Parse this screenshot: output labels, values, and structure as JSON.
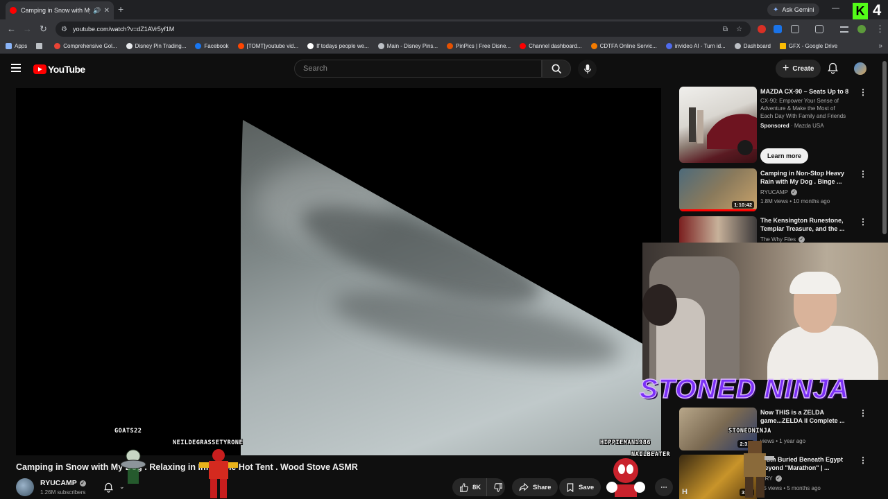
{
  "browser": {
    "tab_title": "Camping in Snow with My",
    "url": "youtube.com/watch?v=dZ1AVr5yf1M",
    "ask_gemini": "Ask Gemini",
    "k_count": "4",
    "bookmarks": [
      {
        "label": "Apps",
        "color": "#8ab4f8"
      },
      {
        "label": "Comprehensive Gol...",
        "color": "#ea4335"
      },
      {
        "label": "Disney Pin Trading...",
        "color": "#e8eaed"
      },
      {
        "label": "Facebook",
        "color": "#1877f2"
      },
      {
        "label": "[TOMT]youtube vid...",
        "color": "#ff4500"
      },
      {
        "label": "If todays people we...",
        "color": "#ffffff"
      },
      {
        "label": "Main - Disney Pins...",
        "color": "#bdc1c6"
      },
      {
        "label": "PinPics | Free Disne...",
        "color": "#e65100"
      },
      {
        "label": "Channel dashboard...",
        "color": "#ff0000"
      },
      {
        "label": "CDTFA Online Servic...",
        "color": "#f57c00"
      },
      {
        "label": "invideo AI - Turn id...",
        "color": "#4f6bed"
      },
      {
        "label": "Dashboard",
        "color": "#bdc1c6"
      },
      {
        "label": "GFX - Google Drive",
        "color": "#fbbc04"
      }
    ]
  },
  "youtube": {
    "logo_text": "YouTube",
    "search_placeholder": "Search",
    "create_label": "Create"
  },
  "video": {
    "title": "Camping in Snow with My Dog . Relaxing in Inflatable Hot Tent . Wood Stove ASMR",
    "channel": "RYUCAMP",
    "subscribers": "1.26M subscribers",
    "likes": "8K",
    "share_label": "Share",
    "save_label": "Save"
  },
  "sidebar": {
    "ad": {
      "title": "MAZDA CX-90 – Seats Up to 8",
      "description": "CX-90: Empower Your Sense of Adventure & Make the Most of Each Day With Family and Friends",
      "sponsored": "Sponsored",
      "advertiser": "Mazda USA",
      "cta": "Learn more"
    },
    "videos": [
      {
        "title": "Camping in Non-Stop Heavy Rain with My Dog . Binge ...",
        "channel": "RYUCAMP",
        "meta": "1.8M views • 10 months ago",
        "duration": "1:10:42"
      },
      {
        "title": "The Kensington Runestone, Templar Treasure, and the ...",
        "channel": "The Why Files",
        "meta": "",
        "duration": ""
      },
      {
        "title": "Now THIS is a ZELDA game...ZELDA II Complete ...",
        "channel": "",
        "meta": "views • 1 year ago",
        "duration": "2:31:"
      },
      {
        "title": "Truth Buried Beneath Egypt Beyond \"Marathon\" | ...",
        "channel": "...RY",
        "meta": "35 views • 5 months ago",
        "duration": "3:30"
      }
    ]
  },
  "overlay": {
    "streamer_title": "STONED NINJA",
    "chatters": [
      "GOATS22",
      "NEILDEGRASSETYRONE",
      "HIPPIEMAN1986",
      "NAILBEATER",
      "STONEDNINJA"
    ]
  }
}
